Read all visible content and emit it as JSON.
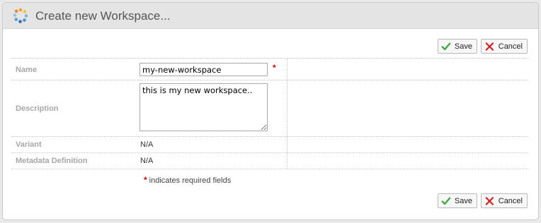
{
  "dialog": {
    "title": "Create new Workspace...",
    "logo_icon": "workspace-logo-icon",
    "colors": {
      "title_bar": "#e4e4e4",
      "required_star": "#d40000",
      "save_check": "#3aa63a",
      "cancel_x": "#d02020",
      "label_gray": "#a7a7a7"
    }
  },
  "toolbar": {
    "save_label": "Save",
    "cancel_label": "Cancel",
    "save_icon": "checkmark-icon",
    "cancel_icon": "x-icon"
  },
  "form": {
    "name": {
      "label": "Name",
      "value": "my-new-workspace"
    },
    "description": {
      "label": "Description",
      "value": "this is my new workspace.."
    },
    "variant": {
      "label": "Variant",
      "value": "N/A"
    },
    "metadata_definition": {
      "label": "Metadata Definition",
      "value": "N/A"
    },
    "required_marker": "*",
    "required_note": "indicates required fields"
  }
}
